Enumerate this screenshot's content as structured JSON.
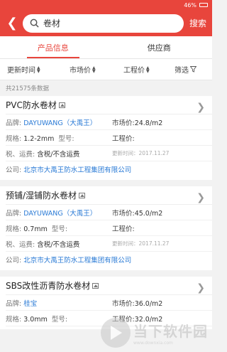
{
  "status": {
    "battery": "46%"
  },
  "header": {
    "search_value": "卷材",
    "search_label": "搜索"
  },
  "tabs": [
    {
      "label": "产品信息"
    },
    {
      "label": "供应商"
    }
  ],
  "sort": [
    "更新时间",
    "市场价",
    "工程价",
    "筛选"
  ],
  "count_text": "共21575条数据",
  "products": [
    {
      "title": "PVC防水卷材",
      "brand_label": "品牌:",
      "brand": "DAYUWANG（大禹王）",
      "market_label": "市场价:",
      "market": "24.8/m2",
      "spec_label": "规格:",
      "spec": "1.2-2mm",
      "model_label": "型号:",
      "project_label": "工程价:",
      "tax_label": "税、运费:",
      "tax": "含税/不含运费",
      "updated": "更新时间：2017.11.27",
      "company_label": "公司:",
      "company": "北京市大禹王防水工程集团有限公司"
    },
    {
      "title": "预铺/湿铺防水卷材",
      "brand_label": "品牌:",
      "brand": "DAYUWANG（大禹王）",
      "market_label": "市场价:",
      "market": "45.0/m2",
      "spec_label": "规格:",
      "spec": "0.7mm",
      "model_label": "型号:",
      "project_label": "工程价:",
      "tax_label": "税、运费:",
      "tax": "含税/不含运费",
      "updated": "更新时间：2017.11.27",
      "company_label": "公司:",
      "company": "北京市大禹王防水工程集团有限公司"
    },
    {
      "title": "SBS改性沥青防水卷材",
      "brand_label": "品牌:",
      "brand": "桂宝",
      "market_label": "市场价:",
      "market": "36.0/m2",
      "spec_label": "规格:",
      "spec": "3.0mm",
      "model_label": "型号:",
      "project_label": "工程价:",
      "project": "32.0/m2"
    }
  ],
  "watermark": {
    "name": "当下软件园",
    "url": "www.downxia.com"
  }
}
